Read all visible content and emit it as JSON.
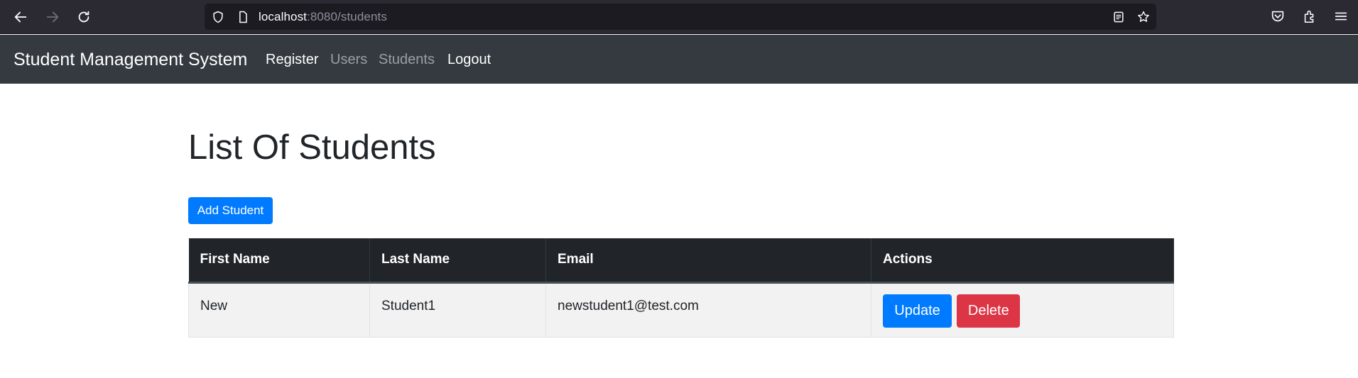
{
  "browser": {
    "url_host": "localhost",
    "url_rest": ":8080/students"
  },
  "navbar": {
    "brand": "Student Management System",
    "links": [
      {
        "label": "Register",
        "state": "active"
      },
      {
        "label": "Users",
        "state": "muted"
      },
      {
        "label": "Students",
        "state": "muted"
      },
      {
        "label": "Logout",
        "state": "active"
      }
    ]
  },
  "main": {
    "title": "List Of Students",
    "add_button": "Add Student",
    "table": {
      "headers": [
        "First Name",
        "Last Name",
        "Email",
        "Actions"
      ],
      "rows": [
        {
          "first_name": "New",
          "last_name": "Student1",
          "email": "newstudent1@test.com"
        }
      ],
      "update_label": "Update",
      "delete_label": "Delete"
    }
  },
  "colors": {
    "primary": "#007bff",
    "danger": "#dc3545",
    "navbar_bg": "#343a40",
    "table_head_bg": "#212529"
  }
}
